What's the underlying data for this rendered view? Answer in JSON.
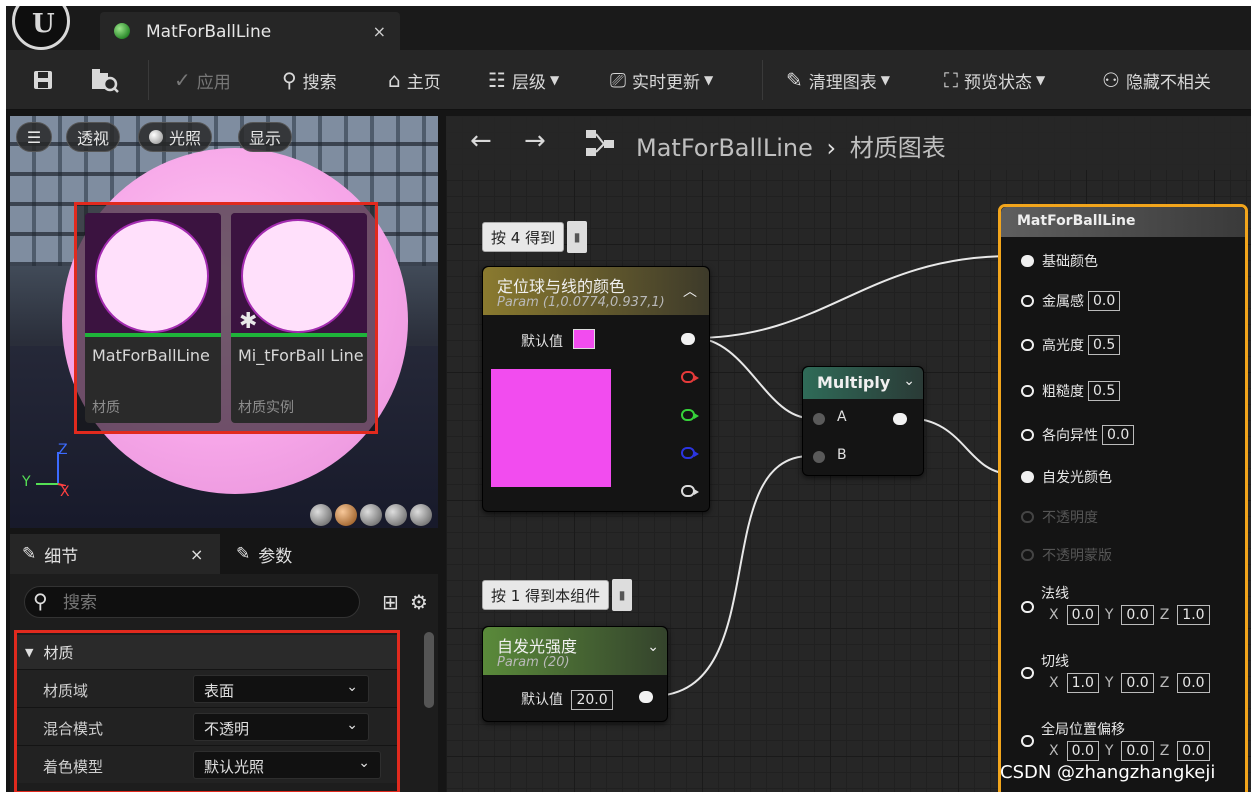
{
  "tab": {
    "title": "MatForBallLine",
    "close": "×"
  },
  "toolbar": {
    "apply": "应用",
    "search": "搜索",
    "home": "主页",
    "hierarchy": "层级",
    "live_update": "实时更新",
    "clean_graph": "清理图表",
    "preview_state": "预览状态",
    "hide_unrelated": "隐藏不相关"
  },
  "viewport": {
    "menu": "☰",
    "perspective": "透视",
    "lighting": "光照",
    "show": "显示",
    "axis_x": "X",
    "axis_y": "Y",
    "axis_z": "Z"
  },
  "assets": [
    {
      "name": "MatForBallLine",
      "type": "材质"
    },
    {
      "name": "Mi_tForBall Line",
      "type": "材质实例"
    }
  ],
  "details": {
    "tab_details": "细节",
    "tab_params": "参数",
    "close": "×",
    "search_placeholder": "搜索",
    "category": "材质",
    "rows": [
      {
        "label": "材质域",
        "value": "表面"
      },
      {
        "label": "混合模式",
        "value": "不透明"
      },
      {
        "label": "着色模型",
        "value": "默认光照"
      }
    ]
  },
  "graph": {
    "breadcrumb_asset": "MatForBallLine",
    "breadcrumb_sep": "›",
    "breadcrumb_graph": "材质图表",
    "comment1": "按 4 得到",
    "comment2": "按 1 得到本组件",
    "vector_node": {
      "title": "定位球与线的颜色",
      "subtitle": "Param (1,0.0774,0.937,1)",
      "default_label": "默认值"
    },
    "multiply_node": {
      "title": "Multiply",
      "pin_a": "A",
      "pin_b": "B"
    },
    "scalar_node": {
      "title": "自发光强度",
      "subtitle": "Param (20)",
      "default_label": "默认值",
      "default_value": "20.0"
    },
    "output_node": {
      "title": "MatForBallLine",
      "base_color": "基础颜色",
      "metallic": "金属感",
      "metallic_value": "0.0",
      "specular": "高光度",
      "specular_value": "0.5",
      "roughness": "粗糙度",
      "roughness_value": "0.5",
      "anisotropy": "各向异性",
      "anisotropy_value": "0.0",
      "emissive": "自发光颜色",
      "opacity": "不透明度",
      "opacity_mask": "不透明蒙版",
      "normal": "法线",
      "normal_x": "0.0",
      "normal_y": "0.0",
      "normal_z": "1.0",
      "tangent": "切线",
      "tangent_x": "1.0",
      "tangent_y": "0.0",
      "tangent_z": "0.0",
      "wpo": "全局位置偏移",
      "wpo_x": "0.0",
      "wpo_y": "0.0",
      "wpo_z": "0.0",
      "axis_x": "X",
      "axis_y": "Y",
      "axis_z": "Z"
    }
  },
  "colors": {
    "vector_param": "#f24cef",
    "selection_border": "#e12a1e",
    "output_border": "#f2a51c"
  },
  "watermark": "CSDN @zhangzhangkeji"
}
